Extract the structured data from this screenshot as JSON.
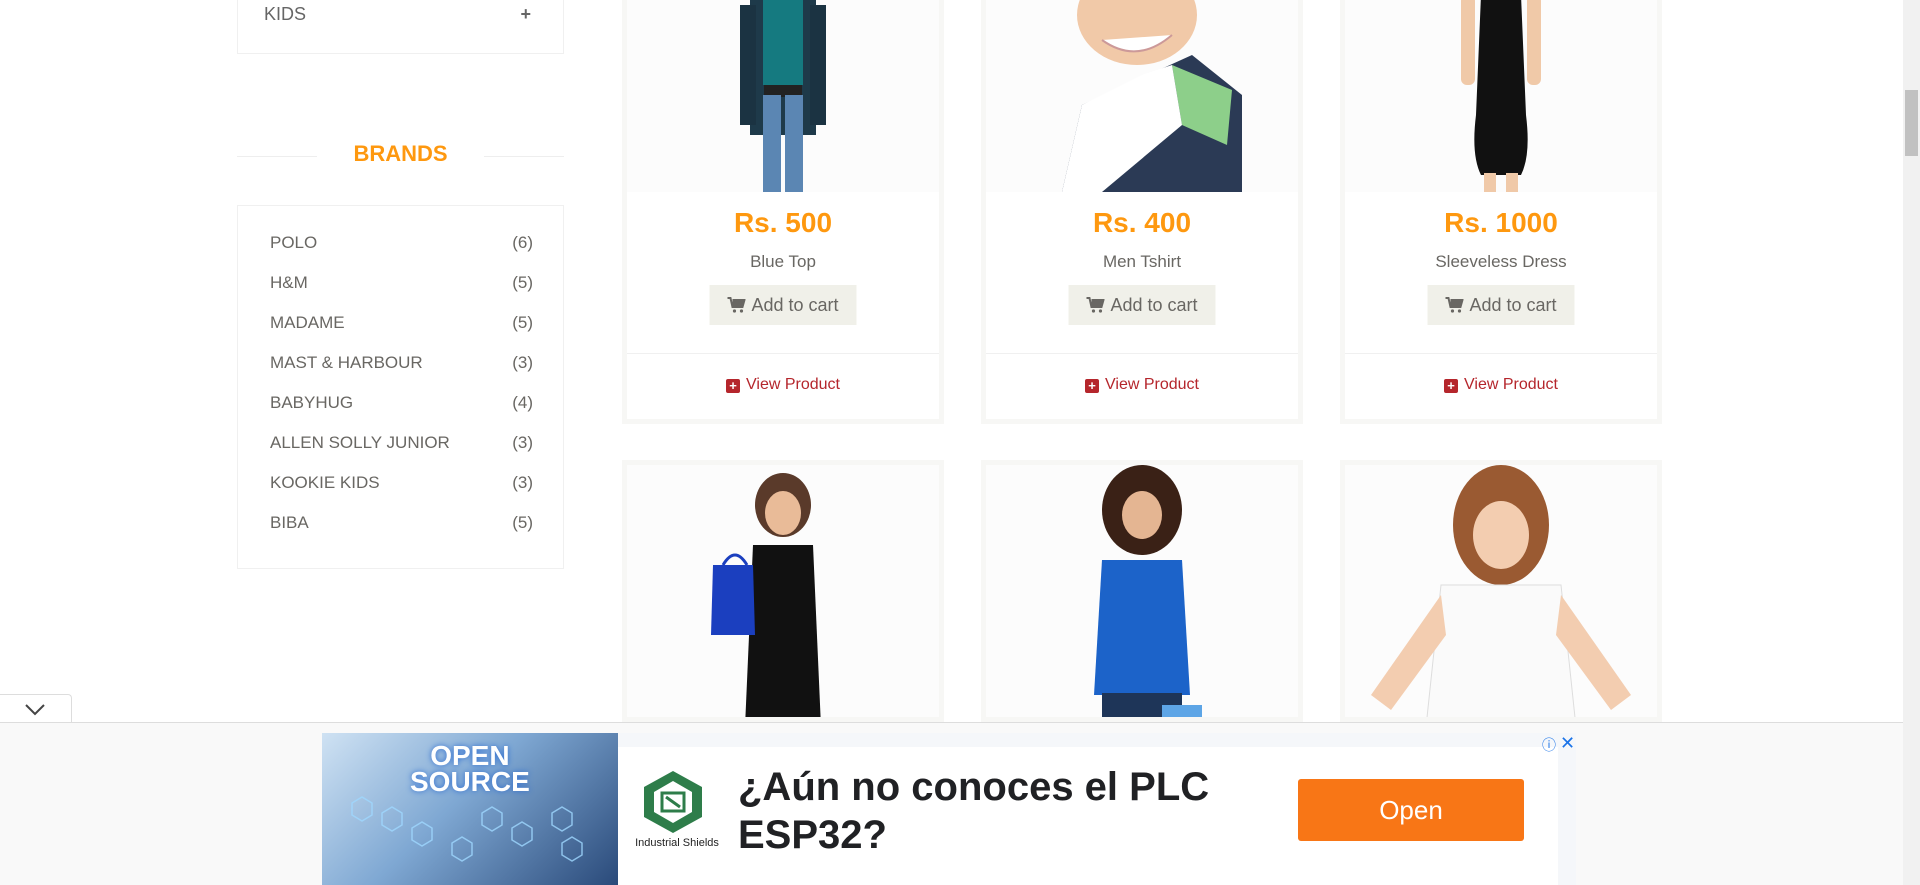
{
  "sidebar": {
    "category": {
      "label": "KIDS",
      "toggle": "+"
    },
    "brands_title": "BRANDS",
    "brands": [
      {
        "name": "POLO",
        "count": "(6)"
      },
      {
        "name": "H&M",
        "count": "(5)"
      },
      {
        "name": "MADAME",
        "count": "(5)"
      },
      {
        "name": "MAST & HARBOUR",
        "count": "(3)"
      },
      {
        "name": "BABYHUG",
        "count": "(4)"
      },
      {
        "name": "ALLEN SOLLY JUNIOR",
        "count": "(3)"
      },
      {
        "name": "KOOKIE KIDS",
        "count": "(3)"
      },
      {
        "name": "BIBA",
        "count": "(5)"
      }
    ]
  },
  "products": [
    {
      "price": "Rs. 500",
      "name": "Blue Top",
      "cart_label": "Add to cart",
      "view_label": "View Product",
      "image": "woman-blue-top"
    },
    {
      "price": "Rs. 400",
      "name": "Men Tshirt",
      "cart_label": "Add to cart",
      "view_label": "View Product",
      "image": "man-tshirt"
    },
    {
      "price": "Rs. 1000",
      "name": "Sleeveless Dress",
      "cart_label": "Add to cart",
      "view_label": "View Product",
      "image": "woman-black-dress"
    },
    {
      "image": "woman-black-dress-shopping-bag"
    },
    {
      "image": "woman-blue-sweater"
    },
    {
      "image": "girl-white-tshirt"
    }
  ],
  "ad": {
    "image_text_line1": "OPEN",
    "image_text_line2": "SOURCE",
    "brand": "Industrial Shields",
    "headline": "¿Aún no conoces el PLC ESP32?",
    "cta": "Open",
    "info_icon": "info-icon",
    "close_icon": "close-icon"
  },
  "colors": {
    "accent": "#FE980F",
    "view_link": "#b5262c",
    "ad_button": "#f87616"
  }
}
